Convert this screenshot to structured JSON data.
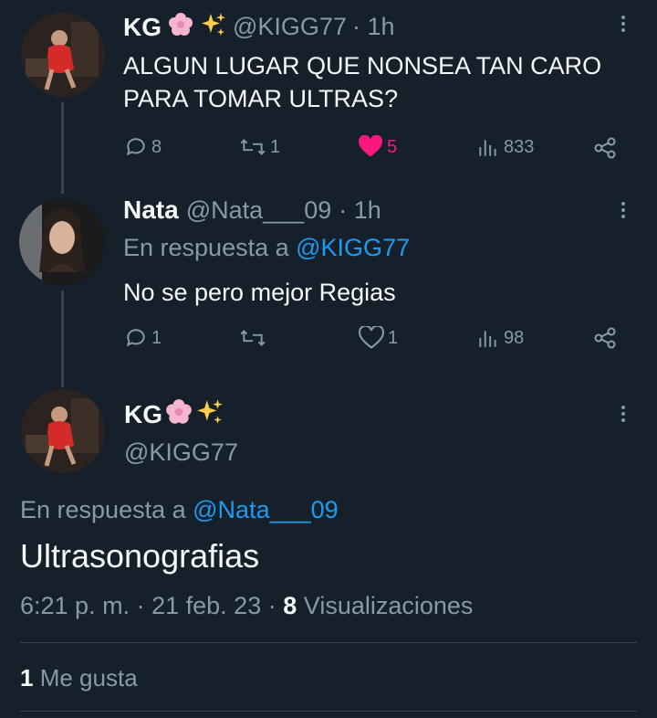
{
  "tweet1": {
    "name": "KG",
    "emoji": [
      "blossom",
      "sparkles"
    ],
    "handle": "@KIGG77",
    "time": "· 1h",
    "text": "ALGUN LUGAR QUE NONSEA TAN CARO PARA TOMAR ULTRAS?",
    "replies": "8",
    "retweets": "1",
    "likes": "5",
    "views": "833",
    "liked": true,
    "colors": {
      "like": "#f91880"
    }
  },
  "tweet2": {
    "name": "Nata",
    "handle": "@Nata___09",
    "time": "· 1h",
    "reply_prefix": "En respuesta a",
    "reply_to": "@KIGG77",
    "text": "No se pero mejor Regias",
    "replies": "1",
    "retweets": "",
    "likes": "1",
    "views": "98"
  },
  "main": {
    "name": "KG",
    "emoji": [
      "blossom",
      "sparkles"
    ],
    "handle": "@KIGG77",
    "reply_prefix": "En respuesta a",
    "reply_to": "@Nata___09",
    "text": "Ultrasonografias",
    "time": "6:21 p. m.",
    "date": "21 feb. 23",
    "views_count": "8",
    "views_label": "Visualizaciones",
    "likes_count": "1",
    "likes_label": "Me gusta"
  },
  "colors": {
    "background": "#15202b",
    "text": "#f7f9f9",
    "muted": "#8b98a5",
    "link": "#1d9bf0",
    "divider": "#38444d"
  }
}
